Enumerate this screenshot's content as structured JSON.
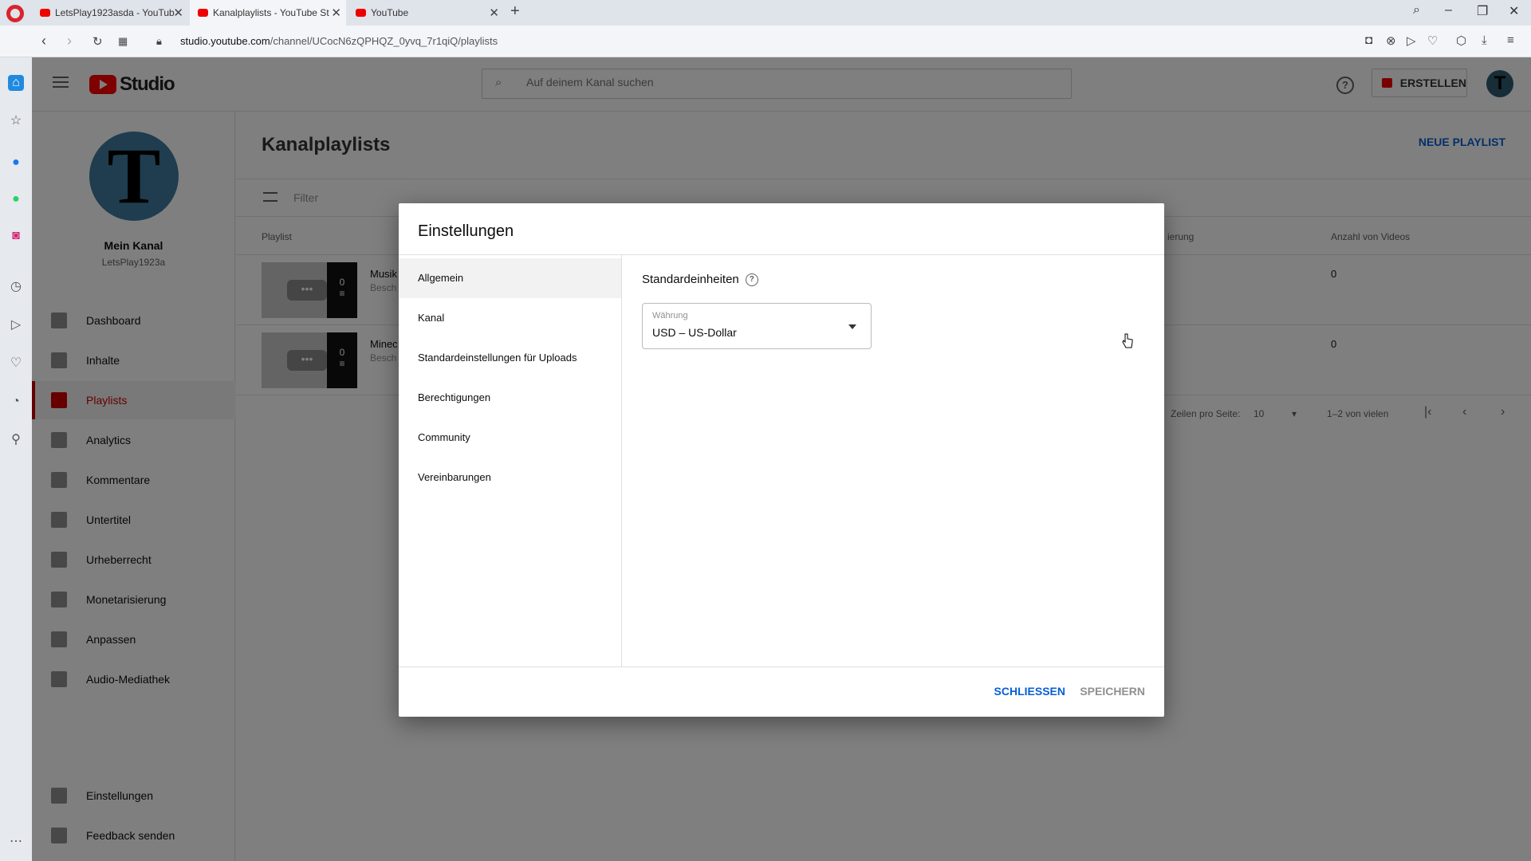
{
  "browser": {
    "tabs": [
      {
        "title": "LetsPlay1923asda - YouTub"
      },
      {
        "title": "Kanalplaylists - YouTube St"
      },
      {
        "title": "YouTube"
      }
    ],
    "url_host": "studio.youtube.com",
    "url_path": "/channel/UCocN6zQPHQZ_0yvq_7r1qiQ/playlists"
  },
  "header": {
    "logo_text": "Studio",
    "search_placeholder": "Auf deinem Kanal suchen",
    "create_label": "ERSTELLEN",
    "avatar_letter": "T"
  },
  "sidebar": {
    "avatar_letter": "T",
    "channel_name": "Mein Kanal",
    "channel_handle": "LetsPlay1923a",
    "items": [
      {
        "label": "Dashboard"
      },
      {
        "label": "Inhalte"
      },
      {
        "label": "Playlists"
      },
      {
        "label": "Analytics"
      },
      {
        "label": "Kommentare"
      },
      {
        "label": "Untertitel"
      },
      {
        "label": "Urheberrecht"
      },
      {
        "label": "Monetarisierung"
      },
      {
        "label": "Anpassen"
      },
      {
        "label": "Audio-Mediathek"
      }
    ],
    "bottom_items": [
      {
        "label": "Einstellungen"
      },
      {
        "label": "Feedback senden"
      }
    ]
  },
  "main": {
    "title": "Kanalplaylists",
    "new_playlist_label": "NEUE PLAYLIST",
    "filter_label": "Filter",
    "columns": {
      "playlist": "Playlist",
      "visibility_partial": "ierung",
      "video_count": "Anzahl von Videos"
    },
    "rows": [
      {
        "name": "Musik",
        "desc": "Besch",
        "count_badge": "0",
        "video_count": "0"
      },
      {
        "name": "Minec",
        "desc": "Besch",
        "count_badge": "0",
        "video_count": "0"
      }
    ],
    "pagination": {
      "rows_per_page_label": "Zeilen pro Seite:",
      "rows_per_page": "10",
      "range": "1–2 von vielen"
    }
  },
  "dialog": {
    "title": "Einstellungen",
    "nav": [
      {
        "label": "Allgemein"
      },
      {
        "label": "Kanal"
      },
      {
        "label": "Standardeinstellungen für Uploads"
      },
      {
        "label": "Berechtigungen"
      },
      {
        "label": "Community"
      },
      {
        "label": "Vereinbarungen"
      }
    ],
    "section_title": "Standardeinheiten",
    "currency": {
      "label": "Währung",
      "value": "USD – US-Dollar"
    },
    "close_label": "SCHLIESSEN",
    "save_label": "SPEICHERN"
  }
}
